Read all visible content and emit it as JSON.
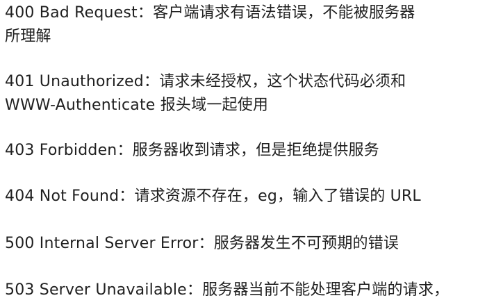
{
  "entries": [
    {
      "code_desc": "400 Bad Request：",
      "line1": "客户端请求有语法错误，不能被服务器",
      "line2": "所理解"
    },
    {
      "code_desc": "401 Unauthorized：",
      "line1": "请求未经授权，这个状态代码必须和",
      "line2": "WWW-Authenticate 报头域一起使用"
    },
    {
      "code_desc": "403 Forbidden：",
      "line1": "服务器收到请求，但是拒绝提供服务"
    },
    {
      "code_desc": "404 Not Found：",
      "line1": "请求资源不存在，eg，输入了错误的 URL"
    },
    {
      "code_desc": "500 Internal Server Error：",
      "line1": "服务器发生不可预期的错误"
    },
    {
      "code_desc": "503 Server Unavailable：",
      "line1": "服务器当前不能处理客户端的请求，"
    }
  ]
}
